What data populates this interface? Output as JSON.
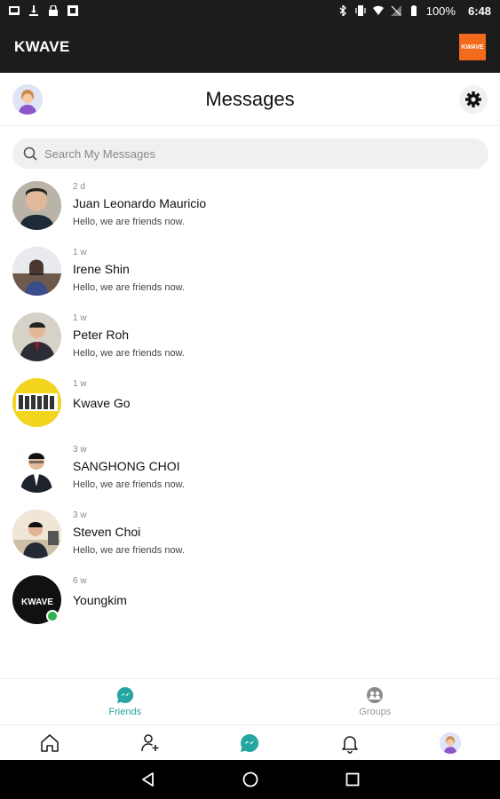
{
  "status_bar": {
    "battery": "100%",
    "time": "6:48"
  },
  "app_bar": {
    "title": "KWAVE",
    "logo_text": "KWAVE"
  },
  "header": {
    "title": "Messages"
  },
  "search": {
    "placeholder": "Search My Messages"
  },
  "conversations": [
    {
      "name": "Juan Leonardo Mauricio",
      "time": "2 d",
      "preview": "Hello, we are friends now."
    },
    {
      "name": "Irene Shin",
      "time": "1 w",
      "preview": "Hello, we are friends now."
    },
    {
      "name": "Peter Roh",
      "time": "1 w",
      "preview": "Hello, we are friends now."
    },
    {
      "name": "Kwave Go",
      "time": "1 w",
      "preview": ""
    },
    {
      "name": "SANGHONG CHOI",
      "time": "3 w",
      "preview": "Hello, we are friends now."
    },
    {
      "name": "Steven Choi",
      "time": "3 w",
      "preview": "Hello, we are friends now."
    },
    {
      "name": "Youngkim",
      "time": "6 w",
      "preview": ""
    }
  ],
  "tabs": [
    {
      "label": "Friends"
    },
    {
      "label": "Groups"
    }
  ],
  "colors": {
    "accent": "#26a6a0",
    "logo": "#f26a1b",
    "online": "#2fb24c"
  }
}
